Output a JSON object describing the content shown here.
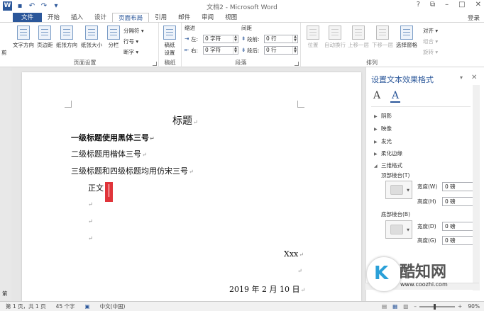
{
  "title_bar": {
    "title": "文档2 - Microsoft Word",
    "app_icon": "W",
    "help": "?",
    "restore": "⧉",
    "minimize": "–",
    "maximize": "□",
    "close": "✕"
  },
  "tabs": [
    "文件",
    "开始",
    "插入",
    "设计",
    "页面布局",
    "引用",
    "邮件",
    "审阅",
    "视图"
  ],
  "active_tab": "页面布局",
  "sign_in": "登录",
  "ribbon": {
    "page_setup": {
      "label": "页面设置",
      "buttons": [
        "文字方向",
        "页边距",
        "纸张方向",
        "纸张大小",
        "分栏"
      ],
      "small": [
        "分隔符 ▾",
        "行号 ▾",
        "断字 ▾"
      ]
    },
    "manuscript": {
      "label": "稿纸",
      "button": "稿纸\n设置"
    },
    "paragraph": {
      "label": "段落",
      "indent_label": "缩进",
      "spacing_label": "间距",
      "left_label": "左:",
      "right_label": "右:",
      "before_label": "段前:",
      "after_label": "段后:",
      "left_value": "0 字符",
      "right_value": "0 字符",
      "before_value": "0 行",
      "after_value": "0 行"
    },
    "arrange": {
      "label": "排列",
      "buttons": [
        "位置",
        "自动换行",
        "上移一层",
        "下移一层",
        "选择窗格"
      ],
      "small": [
        "对齐 ▾",
        "组合 ▾",
        "旋转 ▾"
      ]
    }
  },
  "document": {
    "title": "标题",
    "h1": "一级标题使用黑体三号",
    "h2": "二级标题用楷体三号",
    "h3": "三级标题和四级标题均用仿宋三号",
    "body": "正文",
    "signature": "Xxx",
    "date": "2019 年 2 月 10 日",
    "para_mark": "↵"
  },
  "pane": {
    "title": "设置文本效果格式",
    "close": "✕",
    "dropdown": "▾",
    "text_fill_icon": "A",
    "text_effects_icon": "A",
    "sections": [
      "阴影",
      "映像",
      "发光",
      "柔化边缘"
    ],
    "expanded_section": "三维格式",
    "top_bevel_label": "顶部棱台(T)",
    "bottom_bevel_label": "底部棱台(B)",
    "width_top_label": "宽度(W)",
    "height_top_label": "高度(H)",
    "width_bottom_label": "宽度(D)",
    "height_bottom_label": "高度(G)",
    "top_width": "0 磅",
    "top_height": "0 磅",
    "bottom_width": "0 磅",
    "bottom_height": "0 磅"
  },
  "watermark": {
    "brand": "酷知网",
    "logo_letter": "K",
    "url": "www.coozhi.com"
  },
  "left_strip": {
    "top_label": "剪",
    "bottom_label": "第"
  },
  "status_bar": {
    "page": "第 1 页，共 1 页",
    "words": "45 个字",
    "language": "中文(中国)",
    "zoom": "90%"
  }
}
